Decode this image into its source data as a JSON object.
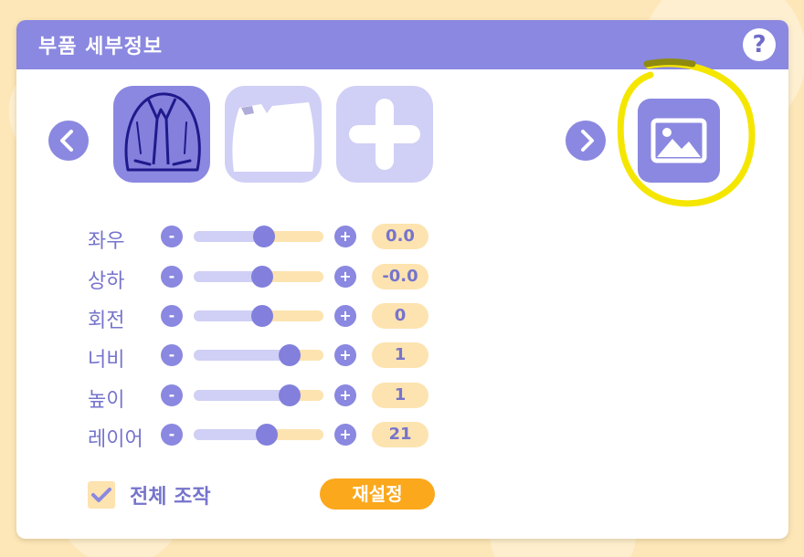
{
  "panel": {
    "title": "부품 세부정보",
    "help_label": "?"
  },
  "icons": {
    "prev": "chevron-left-icon",
    "next": "chevron-right-icon",
    "image": "image-icon",
    "add": "plus-icon",
    "check": "checkmark-icon"
  },
  "parts": [
    {
      "name": "shirt-front",
      "selected": true
    },
    {
      "name": "shirt-white",
      "selected": false
    },
    {
      "name": "add-part",
      "selected": false
    }
  ],
  "controls": [
    {
      "label": "좌우",
      "value": "0.0",
      "slider": 0.54,
      "minus": "-",
      "plus": "+"
    },
    {
      "label": "상하",
      "value": "-0.0",
      "slider": 0.53,
      "minus": "-",
      "plus": "+"
    },
    {
      "label": "회전",
      "value": "0",
      "slider": 0.53,
      "minus": "-",
      "plus": "+"
    },
    {
      "label": "너비",
      "value": "1",
      "slider": 0.74,
      "minus": "-",
      "plus": "+"
    },
    {
      "label": "높이",
      "value": "1",
      "slider": 0.74,
      "minus": "-",
      "plus": "+"
    },
    {
      "label": "레이어",
      "value": "21",
      "slider": 0.56,
      "minus": "-",
      "plus": "+"
    }
  ],
  "footer": {
    "checkbox_label": "전체 조작",
    "checkbox_checked": true,
    "reset_label": "재설정"
  },
  "colors": {
    "accent": "#8a88e0",
    "accent_text": "#7674cc",
    "track_bg": "#fde3b0",
    "track_fill": "#d0cff5",
    "reset": "#fba81c",
    "highlight": "#f5e600"
  }
}
